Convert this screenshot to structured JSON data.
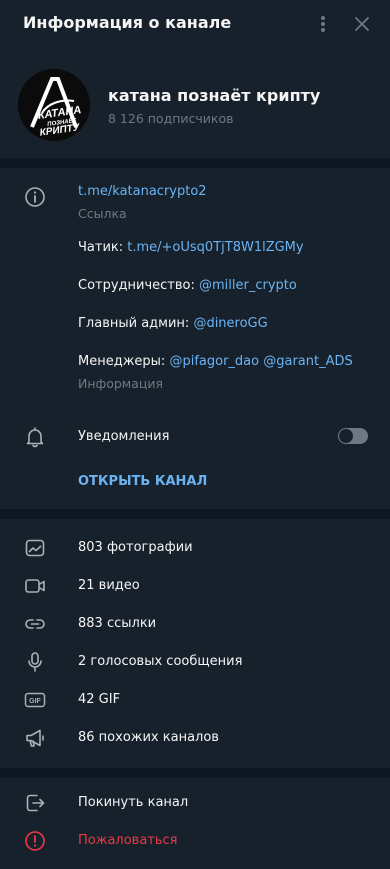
{
  "header": {
    "title": "Информация о канале"
  },
  "channel": {
    "name": "катана познаёт крипту",
    "subscribers": "8 126 подписчиков",
    "avatar_text": [
      "КАТАНА",
      "ПОЗНАЁТ",
      "КРИПТУ"
    ]
  },
  "info": {
    "link": "t.me/katanacrypto2",
    "link_caption": "Ссылка",
    "chat_label": "Чатик: ",
    "chat_link": "t.me/+oUsq0TjT8W1lZGMy",
    "coop_label": "Сотрудничество: ",
    "coop_user": "@miller_crypto",
    "admin_label": "Главный админ: ",
    "admin_user": "@dineroGG",
    "managers_label": "Менеджеры: ",
    "managers_user1": "@pifagor_dao",
    "managers_user2": "@garant_ADS",
    "info_caption": "Информация"
  },
  "notifications": {
    "label": "Уведомления",
    "enabled": false
  },
  "open_channel_label": "ОТКРЫТЬ КАНАЛ",
  "media": [
    {
      "label": "803 фотографии",
      "icon": "photo-icon"
    },
    {
      "label": "21 видео",
      "icon": "video-icon"
    },
    {
      "label": "883 ссылки",
      "icon": "link-icon"
    },
    {
      "label": "2 голосовых сообщения",
      "icon": "microphone-icon"
    },
    {
      "label": "42 GIF",
      "icon": "gif-icon"
    },
    {
      "label": "86 похожих каналов",
      "icon": "megaphone-icon"
    }
  ],
  "actions": {
    "leave": "Покинуть канал",
    "report": "Пожаловаться"
  },
  "gif_icon_text": "GIF",
  "colors": {
    "background": "#17212b",
    "divider": "#0e1621",
    "accent": "#6ab3f3",
    "muted": "#6d7883",
    "danger": "#ec3942"
  }
}
